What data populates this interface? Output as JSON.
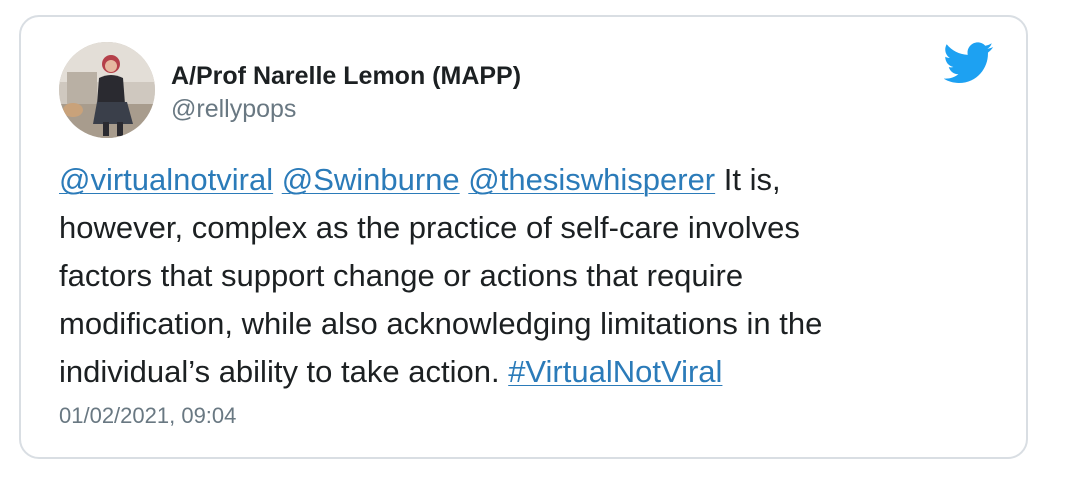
{
  "tweet": {
    "author": {
      "display_name": "A/Prof Narelle Lemon (MAPP)",
      "handle": "@rellypops"
    },
    "logo_icon": "twitter-bird-icon",
    "text": {
      "mention_1": "@virtualnotviral",
      "mention_2": "@Swinburne",
      "mention_3": "@thesiswhisperer",
      "line_1_tail": " It is,",
      "line_2": "however, complex as the practice of self-care involves",
      "line_3": "factors that support change or actions that require",
      "line_4": "modification, while also acknowledging limitations in the",
      "line_5_body": "individual’s ability to take action. ",
      "hashtag": "#VirtualNotViral"
    },
    "timestamp": "01/02/2021, 09:04"
  },
  "colors": {
    "link": "#2b7bb9",
    "text": "#1c2022",
    "secondary": "#697882",
    "twitter_blue": "#1da1f2",
    "border": "#d9dee3"
  }
}
